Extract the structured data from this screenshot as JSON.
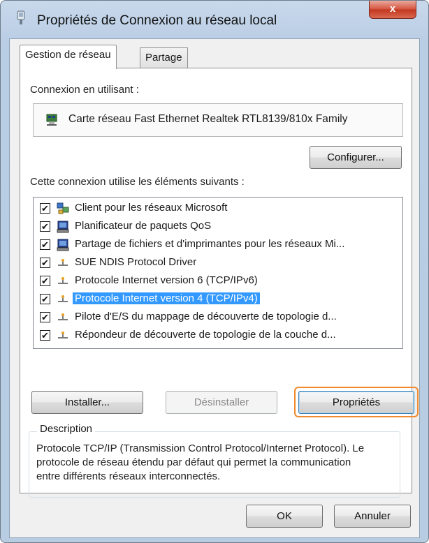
{
  "window": {
    "title": "Propriétés de Connexion au réseau local",
    "close_label": "x"
  },
  "tabs": [
    {
      "label": "Gestion de réseau",
      "active": true
    },
    {
      "label": "Partage",
      "active": false
    }
  ],
  "connection": {
    "label": "Connexion en utilisant :",
    "adapter": "Carte réseau Fast Ethernet Realtek RTL8139/810x Family",
    "configure_button": "Configurer..."
  },
  "components": {
    "label": "Cette connexion utilise les éléments suivants :",
    "items": [
      {
        "label": "Client pour les réseaux Microsoft",
        "checked": true,
        "icon": "network-client-icon"
      },
      {
        "label": "Planificateur de paquets QoS",
        "checked": true,
        "icon": "computer-service-icon"
      },
      {
        "label": "Partage de fichiers et d'imprimantes pour les réseaux Mi...",
        "checked": true,
        "icon": "computer-service-icon"
      },
      {
        "label": "SUE NDIS Protocol Driver",
        "checked": true,
        "icon": "protocol-icon"
      },
      {
        "label": "Protocole Internet version 6 (TCP/IPv6)",
        "checked": true,
        "icon": "protocol-icon"
      },
      {
        "label": "Protocole Internet version 4 (TCP/IPv4)",
        "checked": true,
        "icon": "protocol-icon",
        "selected": true
      },
      {
        "label": "Pilote d'E/S du mappage de découverte de topologie d...",
        "checked": true,
        "icon": "protocol-icon"
      },
      {
        "label": "Répondeur de découverte de topologie de la couche d...",
        "checked": true,
        "icon": "protocol-icon"
      }
    ],
    "check_mark": "✔"
  },
  "buttons": {
    "install": "Installer...",
    "uninstall": "Désinstaller",
    "properties": "Propriétés",
    "ok": "OK",
    "cancel": "Annuler"
  },
  "description": {
    "legend": "Description",
    "text": "Protocole TCP/IP (Transmission Control Protocol/Internet Protocol). Le protocole de réseau étendu par défaut qui permet la communication entre différents réseaux interconnectés."
  },
  "colors": {
    "selection": "#3399ff",
    "highlight_frame": "#f08a2c",
    "close_button": "#c3371f"
  }
}
